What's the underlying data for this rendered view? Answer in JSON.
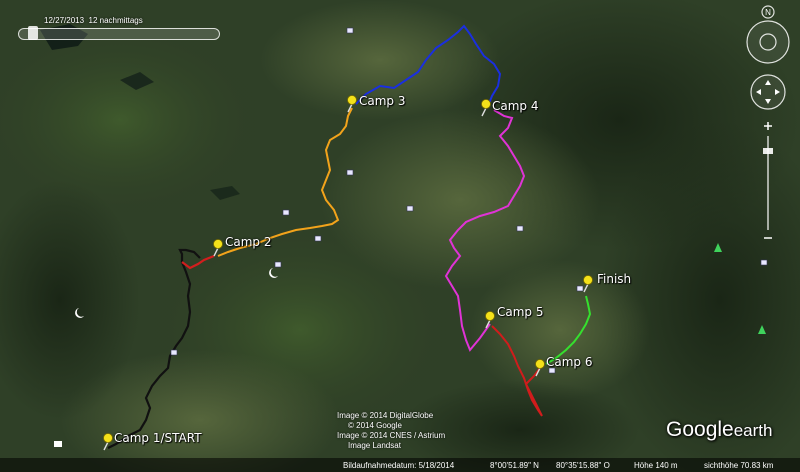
{
  "timebar": {
    "date_label": "12/27/2013",
    "time_label": "12 nachmittags"
  },
  "markers": [
    {
      "name": "camp-1-start",
      "label": "Camp 1/START"
    },
    {
      "name": "camp-2",
      "label": "Camp 2"
    },
    {
      "name": "camp-3",
      "label": "Camp 3"
    },
    {
      "name": "camp-4",
      "label": "Camp 4"
    },
    {
      "name": "camp-5",
      "label": "Camp 5"
    },
    {
      "name": "camp-6",
      "label": "Camp 6"
    },
    {
      "name": "finish",
      "label": "Finish"
    }
  ],
  "route_colors": {
    "stage1": "#111111",
    "stage1b": "#d21e1e",
    "stage2": "#f2a31b",
    "stage3": "#1a2fe0",
    "stage4": "#e033d6",
    "stage5": "#d11c1c",
    "stage6": "#35e02e"
  },
  "credits": {
    "line1": "Image © 2014 DigitalGlobe",
    "line2": "© 2014 Google",
    "line3": "Image © 2014 CNES / Astrium",
    "line4": "Image Landsat"
  },
  "status": {
    "imagery_date": "Bildaufnahmedatum: 5/18/2014",
    "lat": "8°00'51.89\" N",
    "lon": "80°35'15.88\" O",
    "elevation": "Höhe 140 m",
    "eye_alt": "sichthöhe 70.83 km"
  },
  "logo": {
    "brand": "Google",
    "product": "earth"
  },
  "icons": [
    "compass-north-icon",
    "look-joystick-icon",
    "move-joystick-icon",
    "zoom-in-icon",
    "zoom-out-icon",
    "pushpin-icon",
    "hotel-icon",
    "mosque-icon",
    "park-tree-icon",
    "museum-icon"
  ]
}
